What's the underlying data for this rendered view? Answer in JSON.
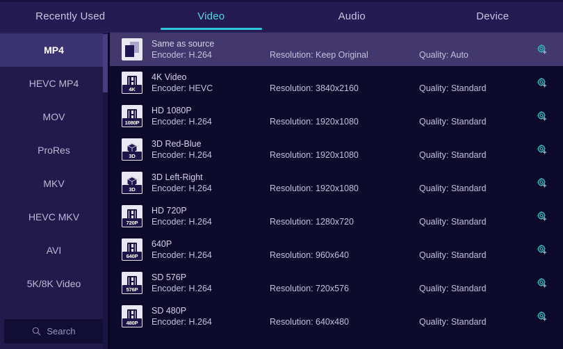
{
  "tabs": [
    {
      "label": "Recently Used",
      "active": false
    },
    {
      "label": "Video",
      "active": true
    },
    {
      "label": "Audio",
      "active": false
    },
    {
      "label": "Device",
      "active": false
    }
  ],
  "sidebar": {
    "items": [
      {
        "label": "MP4",
        "selected": true
      },
      {
        "label": "HEVC MP4",
        "selected": false
      },
      {
        "label": "MOV",
        "selected": false
      },
      {
        "label": "ProRes",
        "selected": false
      },
      {
        "label": "MKV",
        "selected": false
      },
      {
        "label": "HEVC MKV",
        "selected": false
      },
      {
        "label": "AVI",
        "selected": false
      },
      {
        "label": "5K/8K Video",
        "selected": false
      }
    ],
    "search": {
      "label": "Search",
      "placeholder": "Search",
      "icon": "search-icon"
    },
    "scrollbar": {
      "icon": "vertical-scrollbar"
    }
  },
  "presets": [
    {
      "title": "Same as source",
      "encoder": "Encoder: H.264",
      "resolution": "Resolution: Keep Original",
      "quality": "Quality: Auto",
      "icon": "same-as-source-icon",
      "icon_kind": "pages",
      "icon_tag": "",
      "selected": true,
      "settings_icon": "gear-plus-icon"
    },
    {
      "title": "4K Video",
      "encoder": "Encoder: HEVC",
      "resolution": "Resolution: 3840x2160",
      "quality": "Quality: Standard",
      "icon": "film-4k-icon",
      "icon_kind": "film",
      "icon_tag": "4K",
      "selected": false,
      "settings_icon": "gear-plus-icon"
    },
    {
      "title": "HD 1080P",
      "encoder": "Encoder: H.264",
      "resolution": "Resolution: 1920x1080",
      "quality": "Quality: Standard",
      "icon": "film-1080p-icon",
      "icon_kind": "film",
      "icon_tag": "1080P",
      "selected": false,
      "settings_icon": "gear-plus-icon"
    },
    {
      "title": "3D Red-Blue",
      "encoder": "Encoder: H.264",
      "resolution": "Resolution: 1920x1080",
      "quality": "Quality: Standard",
      "icon": "cube-3d-icon",
      "icon_kind": "cube",
      "icon_tag": "3D",
      "selected": false,
      "settings_icon": "gear-plus-icon"
    },
    {
      "title": "3D Left-Right",
      "encoder": "Encoder: H.264",
      "resolution": "Resolution: 1920x1080",
      "quality": "Quality: Standard",
      "icon": "cube-3d-icon",
      "icon_kind": "cube",
      "icon_tag": "3D",
      "selected": false,
      "settings_icon": "gear-plus-icon"
    },
    {
      "title": "HD 720P",
      "encoder": "Encoder: H.264",
      "resolution": "Resolution: 1280x720",
      "quality": "Quality: Standard",
      "icon": "film-720p-icon",
      "icon_kind": "film",
      "icon_tag": "720P",
      "selected": false,
      "settings_icon": "gear-plus-icon"
    },
    {
      "title": "640P",
      "encoder": "Encoder: H.264",
      "resolution": "Resolution: 960x640",
      "quality": "Quality: Standard",
      "icon": "film-640p-icon",
      "icon_kind": "film",
      "icon_tag": "640P",
      "selected": false,
      "settings_icon": "gear-plus-icon"
    },
    {
      "title": "SD 576P",
      "encoder": "Encoder: H.264",
      "resolution": "Resolution: 720x576",
      "quality": "Quality: Standard",
      "icon": "film-576p-icon",
      "icon_kind": "film",
      "icon_tag": "576P",
      "selected": false,
      "settings_icon": "gear-plus-icon"
    },
    {
      "title": "SD 480P",
      "encoder": "Encoder: H.264",
      "resolution": "Resolution: 640x480",
      "quality": "Quality: Standard",
      "icon": "film-480p-icon",
      "icon_kind": "film",
      "icon_tag": "480P",
      "selected": false,
      "settings_icon": "gear-plus-icon"
    }
  ],
  "colors": {
    "header_bg": "#231b52",
    "sidebar_bg": "#211a4a",
    "sidebar_selected": "#3b3371",
    "list_bg": "#0d0a2b",
    "row_selected": "#42386d",
    "accent": "#30c8df",
    "gear": "#35b8bd",
    "text": "#d5d2e8"
  }
}
